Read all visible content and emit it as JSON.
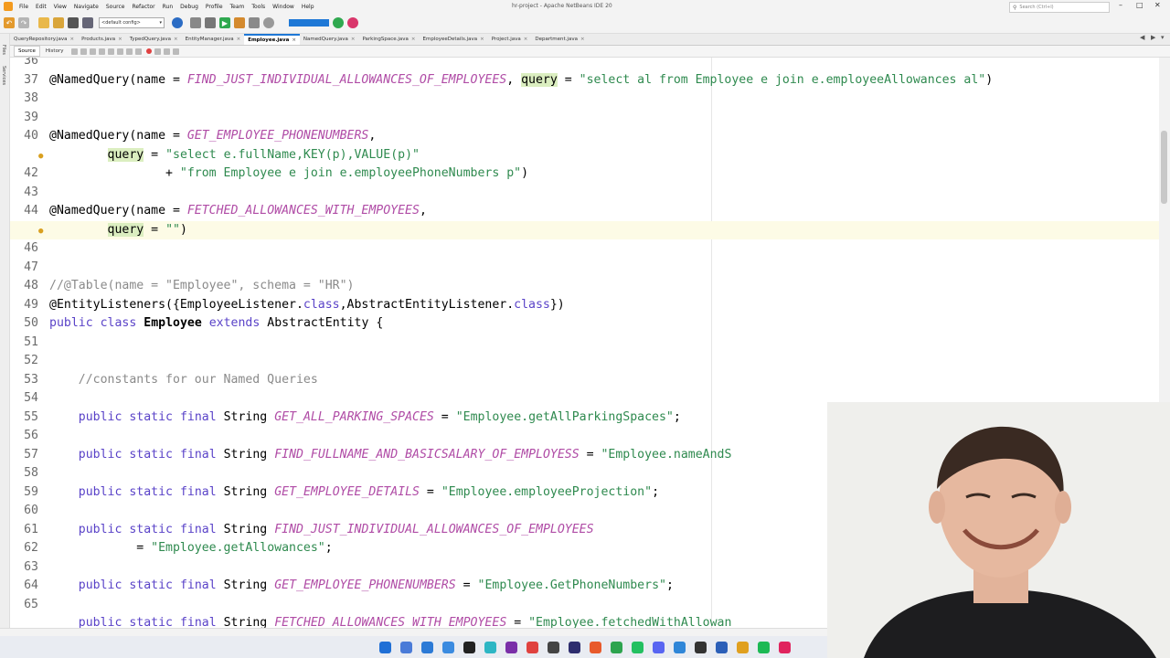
{
  "window": {
    "title": "hr-project - Apache NetBeans IDE 20",
    "search_placeholder": "Search (Ctrl+I)",
    "menu": [
      "File",
      "Edit",
      "View",
      "Navigate",
      "Source",
      "Refactor",
      "Run",
      "Debug",
      "Profile",
      "Team",
      "Tools",
      "Window",
      "Help"
    ]
  },
  "toolbar": {
    "config_label": "<default config>"
  },
  "sidebar": {
    "files_label": "Files",
    "services_label": "Services"
  },
  "tabs": [
    {
      "label": "QueryRepository.java"
    },
    {
      "label": "Products.java"
    },
    {
      "label": "TypedQuery.java"
    },
    {
      "label": "EntityManager.java"
    },
    {
      "label": "Employee.java"
    },
    {
      "label": "NamedQuery.java"
    },
    {
      "label": "ParkingSpace.java"
    },
    {
      "label": "EmployeeDetails.java"
    },
    {
      "label": "Project.java"
    },
    {
      "label": "Department.java"
    }
  ],
  "editor_toolbar": {
    "source_tab": "Source",
    "history_tab": "History"
  },
  "editor": {
    "lines": [
      {
        "num": "36",
        "code": ""
      },
      {
        "num": "37",
        "code": "@NamedQuery(name = FIND_JUST_INDIVIDUAL_ALLOWANCES_OF_EMPLOYEES, query = \"select al from Employee e join e.employeeAllowances al\")"
      },
      {
        "num": "38",
        "code": ""
      },
      {
        "num": "39",
        "code": ""
      },
      {
        "num": "40",
        "code": "@NamedQuery(name = GET_EMPLOYEE_PHONENUMBERS,"
      },
      {
        "num": "",
        "code": "        query = \"select e.fullName,KEY(p),VALUE(p)\""
      },
      {
        "num": "42",
        "code": "                + \"from Employee e join e.employeePhoneNumbers p\")"
      },
      {
        "num": "43",
        "code": ""
      },
      {
        "num": "44",
        "code": "@NamedQuery(name = FETCHED_ALLOWANCES_WITH_EMPOYEES,"
      },
      {
        "num": "",
        "code": "        query = \"\")"
      },
      {
        "num": "46",
        "code": ""
      },
      {
        "num": "47",
        "code": ""
      },
      {
        "num": "48",
        "code": "//@Table(name = \"Employee\", schema = \"HR\")"
      },
      {
        "num": "49",
        "code": "@EntityListeners({EmployeeListener.class,AbstractEntityListener.class})"
      },
      {
        "num": "50",
        "code": "public class Employee extends AbstractEntity {"
      },
      {
        "num": "51",
        "code": ""
      },
      {
        "num": "52",
        "code": ""
      },
      {
        "num": "53",
        "code": "    //constants for our Named Queries"
      },
      {
        "num": "54",
        "code": ""
      },
      {
        "num": "55",
        "code": "    public static final String GET_ALL_PARKING_SPACES = \"Employee.getAllParkingSpaces\";"
      },
      {
        "num": "56",
        "code": ""
      },
      {
        "num": "57",
        "code": "    public static final String FIND_FULLNAME_AND_BASICSALARY_OF_EMPLOYESS = \"Employee.nameAndS"
      },
      {
        "num": "58",
        "code": ""
      },
      {
        "num": "59",
        "code": "    public static final String GET_EMPLOYEE_DETAILS = \"Employee.employeeProjection\";"
      },
      {
        "num": "60",
        "code": ""
      },
      {
        "num": "61",
        "code": "    public static final String FIND_JUST_INDIVIDUAL_ALLOWANCES_OF_EMPLOYEES"
      },
      {
        "num": "62",
        "code": "            = \"Employee.getAllowances\";"
      },
      {
        "num": "63",
        "code": ""
      },
      {
        "num": "64",
        "code": "    public static final String GET_EMPLOYEE_PHONENUMBERS = \"Employee.GetPhoneNumbers\";"
      },
      {
        "num": "65",
        "code": ""
      },
      {
        "num": "",
        "code": "    public static final String FETCHED_ALLOWANCES_WITH_EMPOYEES = \"Employee.fetchedWithAllowan"
      }
    ]
  }
}
